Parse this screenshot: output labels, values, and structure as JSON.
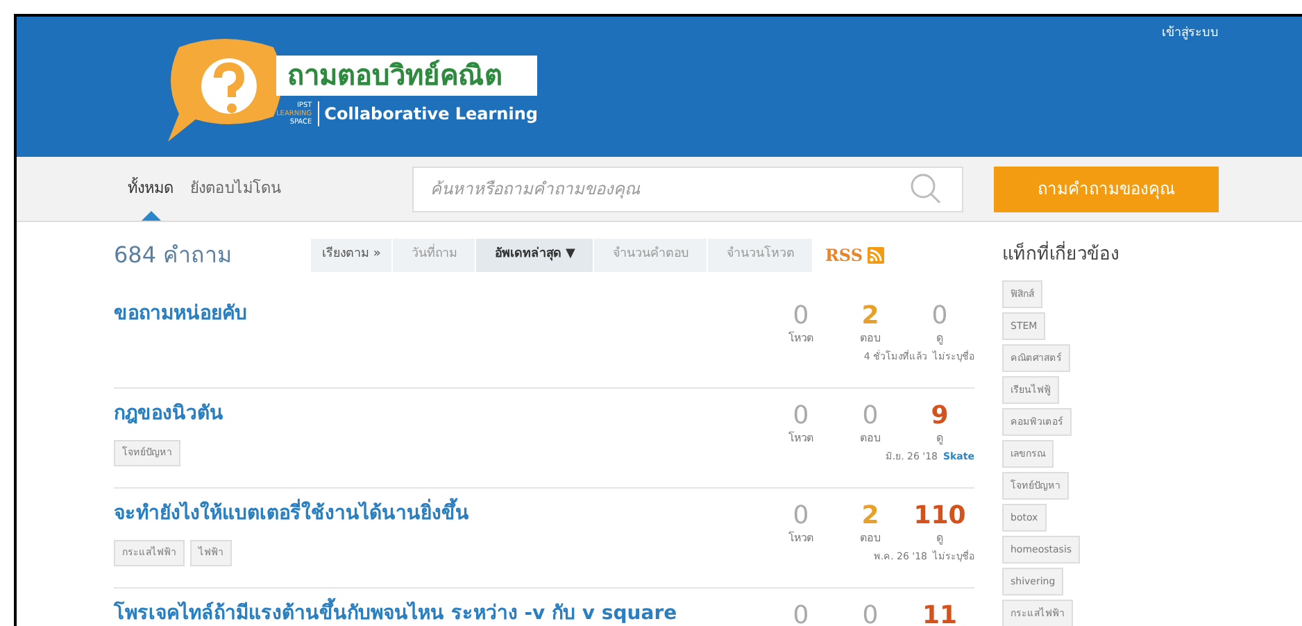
{
  "header": {
    "logo_title": "ถามตอบวิทย์คณิต",
    "logo_sub_1": "IPST",
    "logo_sub_2": "LEARNING",
    "logo_sub_3": "SPACE",
    "logo_tagline": "Collaborative Learning",
    "login": "เข้าสู่ระบบ"
  },
  "nav": {
    "tabs": [
      {
        "label": "ทั้งหมด",
        "selected": true
      },
      {
        "label": "ยังตอบไม่โดน",
        "selected": false
      }
    ],
    "search": {
      "placeholder": "ค้นหาหรือถามคำถามของคุณ"
    },
    "ask_button": "ถามคำถามของคุณ"
  },
  "count": "684 คำถาม",
  "sort": {
    "label": "เรียงตาม »",
    "options": [
      {
        "label": "วันที่ถาม",
        "selected": false
      },
      {
        "label": "อัพเดทล่าสุด ▼",
        "selected": true
      },
      {
        "label": "จำนวนคำตอบ",
        "selected": false
      },
      {
        "label": "จำนวนโหวต",
        "selected": false
      }
    ],
    "rss": "RSS"
  },
  "questions": [
    {
      "title": "ขอถามหน่อยคับ",
      "votes": "0",
      "votes_label": "โหวต",
      "answers": "2",
      "answers_label": "ตอบ",
      "answered": true,
      "views": "0",
      "views_label": "ดู",
      "hot": false,
      "when": "4 ชั่วโมงที่แล้ว",
      "author": "ไม่ระบุชื่อ",
      "author_link": false
    },
    {
      "title": "กฎของนิวตัน",
      "tags": [
        "โจทย์ปัญหา"
      ],
      "votes": "0",
      "votes_label": "โหวต",
      "answers": "0",
      "answers_label": "ตอบ",
      "answered": false,
      "views": "9",
      "views_label": "ดู",
      "hot": true,
      "when": "มิ.ย. 26 '18",
      "author": "Skate",
      "author_link": true
    },
    {
      "title": "จะทำยังไงให้แบตเตอรี่ใช้งานได้นานยิ่งขึ้น",
      "tags": [
        "กระแสไฟฟ้า",
        "ไฟฟ้า"
      ],
      "votes": "0",
      "votes_label": "โหวต",
      "answers": "2",
      "answers_label": "ตอบ",
      "answered": true,
      "views": "110",
      "views_label": "ดู",
      "hot": true,
      "when": "พ.ค. 26 '18",
      "author": "ไม่ระบุชื่อ",
      "author_link": false
    },
    {
      "title": "โพรเจคไทล์ถ้ามีแรงต้านขึ้นกับพจนไหน ระหว่าง -v กับ v square",
      "votes": "0",
      "answers": "0",
      "answered": false,
      "views": "11",
      "hot": true
    }
  ],
  "sidebar": {
    "title": "แท็กที่เกี่ยวข้อง",
    "tags": [
      "ฟิสิกส์",
      "STEM",
      "คณิตศาสตร์",
      "เรียนไฟฟู้",
      "คอมพิวเตอร์",
      "เลขกรณ",
      "โจทย์ปัญหา",
      "botox",
      "homeostasis",
      "shivering",
      "กระแสไฟฟ้า"
    ]
  }
}
